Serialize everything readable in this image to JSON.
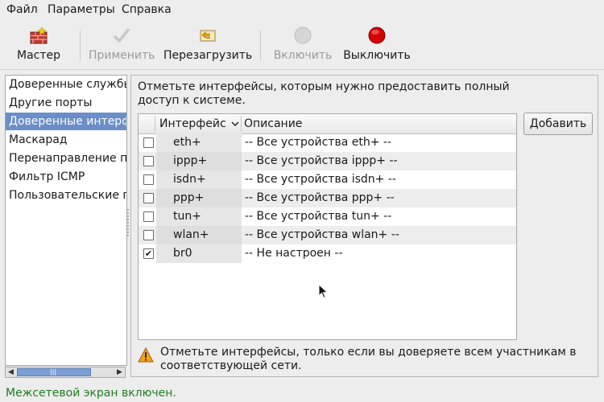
{
  "menu": {
    "file": "Файл",
    "params": "Параметры",
    "help": "Справка"
  },
  "toolbar": {
    "wizard": "Мастер",
    "apply": "Применить",
    "reload": "Перезагрузить",
    "enable": "Включить",
    "disable": "Выключить"
  },
  "sidebar": {
    "items": [
      {
        "label": "Доверенные службы"
      },
      {
        "label": "Другие порты"
      },
      {
        "label": "Доверенные интерфейсы"
      },
      {
        "label": "Маскарад"
      },
      {
        "label": "Перенаправление портов"
      },
      {
        "label": "Фильтр ICMP"
      },
      {
        "label": "Пользовательские правила"
      }
    ],
    "selected_index": 2
  },
  "main": {
    "description": "Отметьте интерфейсы, которым нужно предоставить полный доступ к системе.",
    "add_button": "Добавить",
    "columns": {
      "interface": "Интерфейс",
      "description": "Описание"
    },
    "rows": [
      {
        "iface": "eth+",
        "desc": "-- Все устройства eth+ --",
        "checked": false
      },
      {
        "iface": "ippp+",
        "desc": "-- Все устройства ippp+ --",
        "checked": false
      },
      {
        "iface": "isdn+",
        "desc": "-- Все устройства isdn+ --",
        "checked": false
      },
      {
        "iface": "ppp+",
        "desc": "-- Все устройства ppp+ --",
        "checked": false
      },
      {
        "iface": "tun+",
        "desc": "-- Все устройства tun+ --",
        "checked": false
      },
      {
        "iface": "wlan+",
        "desc": "-- Все устройства wlan+ --",
        "checked": false
      },
      {
        "iface": "br0",
        "desc": "-- Не настроен --",
        "checked": true
      }
    ],
    "check_mark": "✔",
    "warning": "Отметьте интерфейсы, только если вы доверяете всем участникам в соответствующей сети."
  },
  "status": {
    "text": "Межсетевой экран включен.",
    "color": "#1e7d1e"
  },
  "colors": {
    "selection": "#6b8ec8",
    "disable_red": "#d40000"
  }
}
